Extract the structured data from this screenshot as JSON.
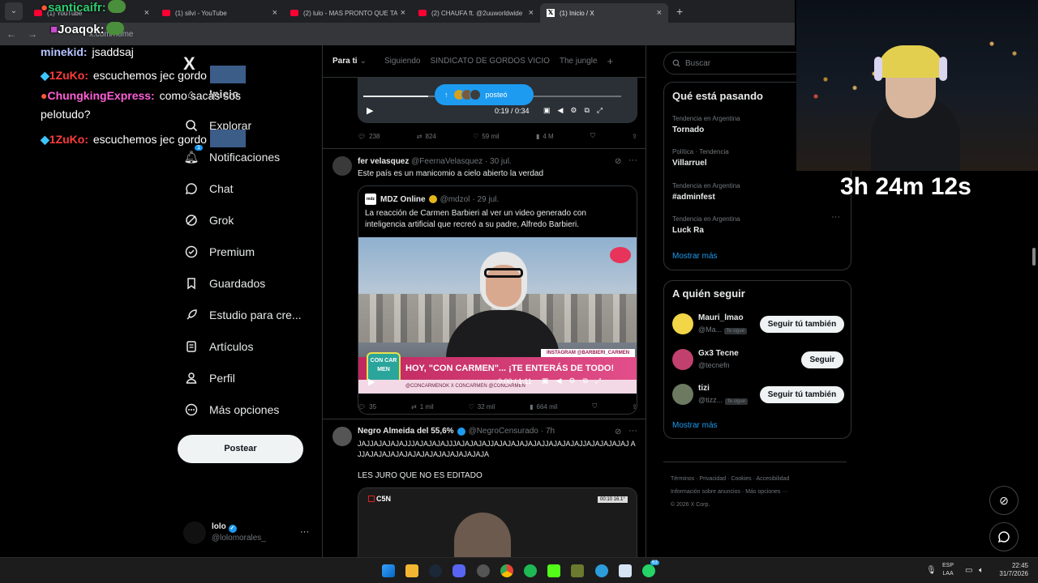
{
  "browser": {
    "tabs": [
      {
        "title": "(1) YouTube",
        "icon": "youtube-icon"
      },
      {
        "title": "(1) silvi - YouTube",
        "icon": "youtube-icon"
      },
      {
        "title": "(2) lulo - MAS PRONTO QUE TA",
        "icon": "youtube-icon"
      },
      {
        "title": "(2) CHAUFA ft. @2uuworldwide",
        "icon": "youtube-icon"
      },
      {
        "title": "(1) Inicio / X",
        "icon": "x-icon",
        "active": true
      }
    ],
    "new_tab": "+",
    "address": "x.com/home"
  },
  "chat": {
    "messages": [
      {
        "user": "santicaifr:",
        "text": "",
        "color": "#2ecc71"
      },
      {
        "user": "Joaqok:",
        "text": "",
        "color": "#ffffff"
      },
      {
        "user": "minekid:",
        "text": "jsaddsaj",
        "color": "#b5c4ff"
      },
      {
        "user": "1ZuKo:",
        "text": "escuchemos jec gordo",
        "color": "#ff3b3b"
      },
      {
        "user": "ChungkingExpress:",
        "text": "como sacas sos",
        "color": "#ff5fd7"
      },
      {
        "user": "",
        "text": "pelotudo?",
        "color": "#ffffff"
      },
      {
        "user": "1ZuKo:",
        "text": "escuchemos jec gordo",
        "color": "#ff3b3b"
      }
    ]
  },
  "sidebar": {
    "logo": "X",
    "items": [
      {
        "label": "Inicio",
        "icon": "home-icon"
      },
      {
        "label": "Explorar",
        "icon": "search-icon"
      },
      {
        "label": "Notificaciones",
        "icon": "bell-icon",
        "badge": "1"
      },
      {
        "label": "Chat",
        "icon": "chat-icon"
      },
      {
        "label": "Grok",
        "icon": "grok-icon"
      },
      {
        "label": "Premium",
        "icon": "premium-icon"
      },
      {
        "label": "Guardados",
        "icon": "bookmark-icon"
      },
      {
        "label": "Estudio para cre...",
        "icon": "rocket-icon"
      },
      {
        "label": "Artículos",
        "icon": "article-icon"
      },
      {
        "label": "Perfil",
        "icon": "person-icon"
      },
      {
        "label": "Más opciones",
        "icon": "more-icon"
      }
    ],
    "post_button": "Postear",
    "account": {
      "name": "lolo",
      "handle": "@lolomorales_",
      "more": "···"
    }
  },
  "feed": {
    "tabs": [
      "Para ti",
      "Siguiendo",
      "SINDICATO DE GORDOS VICIO",
      "The jungle"
    ],
    "add_tab": "+",
    "pill": "posteó",
    "top_post": {
      "video_time": "0:19 / 0:34",
      "replies": "238",
      "reposts": "824",
      "likes": "59 mil",
      "views": "4 M"
    },
    "post2": {
      "name": "fer velasquez",
      "handle": "@FeernaVelasquez",
      "date": "· 30 jul.",
      "text": "Este país es un manicomio a cielo abierto la verdad",
      "quote": {
        "logo": "mdz",
        "name": "MDZ Online",
        "handle": "@mdzol",
        "date": "· 29 jul.",
        "text": "La reacción de Carmen Barbieri al ver un video generado con inteligencia artificial que recreó a su padre, Alfredo Barbieri.",
        "banner": "HOY, \"CON CARMEN\"... ¡TE ENTERÁS DE TODO!",
        "show_logo": "CON CAR MEN",
        "insta_tag": "INSTAGRAM @BARBIERI_CARMEN",
        "video_time": "0:00 / 1:11",
        "subtitle": "@CONCARMENOK   X CONCARMEN   @CONCARMEN"
      },
      "replies": "35",
      "reposts": "1 mil",
      "likes": "32 mil",
      "views": "664 mil"
    },
    "post3": {
      "name": "Negro Almeida del 55,6%",
      "handle": "@NegroCensurado",
      "date": "· 7h",
      "text1": "JAJJAJAJAJAJJJAJAJAJAJJJAJAJAJAJJAJAJAJAJAJAJJAJAJAJAJJAJAJAJAJAJ AJJAJAJAJAJAJAJAJAJAJAJAJAJAJAJA",
      "text2": "LES JURO QUE NO ES EDITADO",
      "channel": "C5N",
      "clock": "00:10 16.1°"
    }
  },
  "right": {
    "search_placeholder": "Buscar",
    "trends_title": "Qué está pasando",
    "trends": [
      {
        "meta": "Tendencia en Argentina",
        "name": "Tornado"
      },
      {
        "meta": "Política · Tendencia",
        "name": "Villarruel"
      },
      {
        "meta": "Tendencia en Argentina",
        "name": "#adminfest"
      },
      {
        "meta": "Tendencia en Argentina",
        "name": "Luck Ra"
      }
    ],
    "more_link": "Mostrar más",
    "follow_title": "A quién seguir",
    "follow": [
      {
        "name": "Mauri_lmao",
        "handle": "@Ma...",
        "follows_you": "Te sigue",
        "button": "Seguir tú también"
      },
      {
        "name": "Gx3 Tecne",
        "handle": "@tecnefn",
        "follows_you": "",
        "button": "Seguir"
      },
      {
        "name": "tizi",
        "handle": "@tizz...",
        "follows_you": "Te sigue",
        "button": "Seguir tú también"
      }
    ],
    "follow_more": "Mostrar más",
    "footer": [
      "Términos",
      "Privacidad",
      "Cookies",
      "Accesibilidad",
      "Información sobre anuncios",
      "Más opciones ···",
      "© 2026 X Corp."
    ]
  },
  "stream": {
    "timer": "3h 24m 12s"
  },
  "taskbar": {
    "lang": "ESP",
    "lang2": "LAA",
    "time": "22:45",
    "date": "31/7/2026",
    "whatsapp_badge": "63"
  },
  "colors": {
    "accent": "#1d9bf0",
    "bg": "#000000",
    "border": "#2f3336",
    "muted": "#71767b"
  }
}
